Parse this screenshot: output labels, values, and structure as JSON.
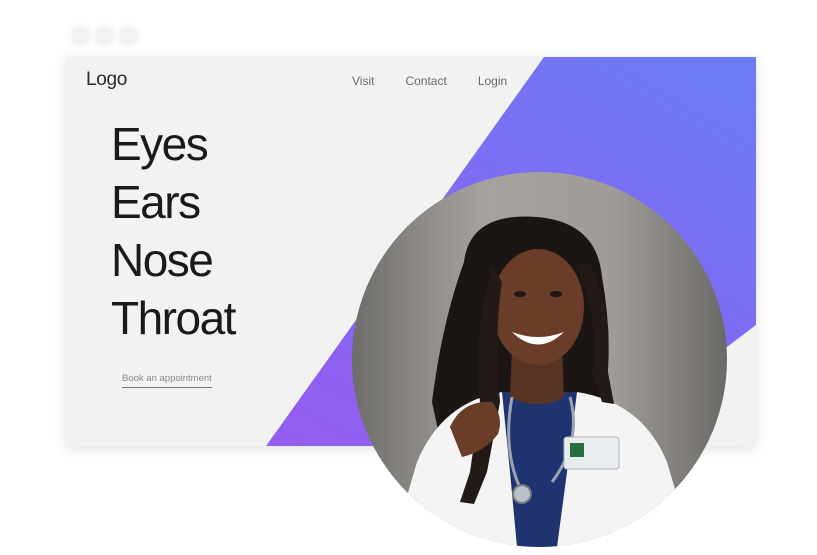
{
  "header": {
    "logo": "Logo"
  },
  "nav": {
    "items": [
      "Visit",
      "Contact",
      "Login"
    ]
  },
  "hero": {
    "lines": [
      "Eyes",
      "Ears",
      "Nose",
      "Throat"
    ]
  },
  "cta": {
    "label": "Book an appointment"
  },
  "colors": {
    "gradient_start": "#6a7cf6",
    "gradient_end": "#9a5bef",
    "window_bg": "#f2f2f2"
  }
}
